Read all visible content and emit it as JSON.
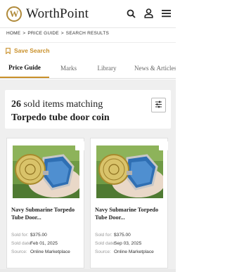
{
  "header": {
    "logo_letter": "W",
    "logo_text": "WorthPoint",
    "icons": [
      "search-icon",
      "user-icon",
      "menu-icon"
    ]
  },
  "breadcrumb": [
    "HOME",
    "PRICE GUIDE",
    "SEARCH RESULTS"
  ],
  "breadcrumb_sep": ">",
  "save_search": {
    "label": "Save Search",
    "icon": "bookmark-icon"
  },
  "tabs": [
    "Price Guide",
    "Marks",
    "Library",
    "News & Articles"
  ],
  "results": {
    "count": "26",
    "count_suffix": "sold items matching",
    "query": "Torpedo tube door coin"
  },
  "items": [
    {
      "title": "Navy Submarine Torpedo Tube Door...",
      "sold_for_label": "Sold for:",
      "sold_for": "$375.00",
      "sold_date_label": "Sold date:",
      "sold_date": "Feb 01, 2025",
      "source_label": "Source:",
      "source": "Online Marketplace"
    },
    {
      "title": "Navy Submarine Torpedo Tube Door...",
      "sold_for_label": "Sold for:",
      "sold_for": "$375.00",
      "sold_date_label": "Sold date:",
      "sold_date": "Sep 03, 2025",
      "source_label": "Source:",
      "source": "Online Marketplace"
    }
  ],
  "colors": {
    "accent": "#c9902a",
    "band": "#efefef"
  }
}
